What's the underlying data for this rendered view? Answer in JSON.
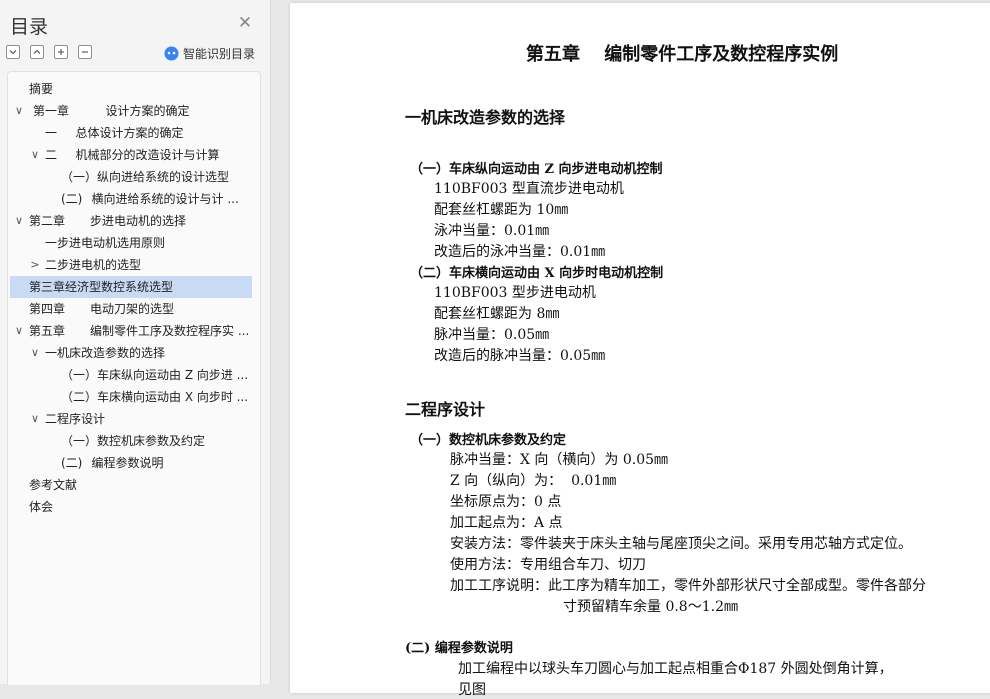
{
  "sidebar": {
    "title": "目录",
    "smart_toc_label": "智能识别目录",
    "toolbar_icons": [
      "collapse-all-icon",
      "expand-all-icon",
      "expand-level-icon",
      "collapse-level-icon"
    ],
    "items": [
      {
        "label": "摘要"
      },
      {
        "label": "第一章\t   设计方案的确定"
      },
      {
        "label": "一\t总体设计方案的确定"
      },
      {
        "label": "二\t机械部分的改造设计与计算"
      },
      {
        "label": "（一）纵向进给系统的设计选型"
      },
      {
        "label": "(二)\t横向进给系统的设计与计 ..."
      },
      {
        "label": "第二章\t步进电动机的选择"
      },
      {
        "label": "一步进电动机选用原则"
      },
      {
        "label": "二步进电机的选型"
      },
      {
        "label": "第三章经济型数控系统选型"
      },
      {
        "label": "第四章\t电动刀架的选型"
      },
      {
        "label": "第五章\t编制零件工序及数控程序实 ..."
      },
      {
        "label": "一机床改造参数的选择"
      },
      {
        "label": "（一）车床纵向运动由 Z 向步进 ..."
      },
      {
        "label": "（二）车床横向运动由 X 向步时 ..."
      },
      {
        "label": "二程序设计"
      },
      {
        "label": "（一）数控机床参数及约定"
      },
      {
        "label": "(二)\t编程参数说明"
      },
      {
        "label": "参考文献"
      },
      {
        "label": "体会"
      }
    ],
    "selected_color": "#c9daf5"
  },
  "document": {
    "chapter_title": "第五章　 编制零件工序及数控程序实例",
    "section1_title": "一机床改造参数的选择",
    "sub1_title": "（一）车床纵向运动由 Z 向步进电动机控制",
    "sub1_lines": [
      "110BF003 型直流步进电动机",
      "配套丝杠螺距为 10㎜",
      "泳冲当量：0.01㎜",
      "改造后的泳冲当量：0.01㎜"
    ],
    "sub2_title": "（二）车床横向运动由 X 向步时电动机控制",
    "sub2_lines": [
      "110BF003 型步进电动机",
      "配套丝杠螺距为 8㎜",
      "脉冲当量：0.05㎜",
      "改造后的脉冲当量：0.05㎜"
    ],
    "section2_title": "二程序设计",
    "sub3_title": "（一）数控机床参数及约定",
    "sub3_lines": [
      "脉冲当量：X 向（横向）为 0.05㎜",
      "Z 向（纵向）为：  0.01㎜",
      "坐标原点为：0 点",
      "加工起点为：A 点",
      "安装方法：零件装夹于床头主轴与尾座顶尖之间。采用专用芯轴方式定位。",
      "使用方法：专用组合车刀、切刀",
      "加工工序说明：此工序为精车加工，零件外部形状尺寸全部成型。零件各部分",
      "寸预留精车余量 0.8～1.2㎜"
    ],
    "sub4_title": "(二) 编程参数说明",
    "sub4_lines": [
      "加工编程中以球头车刀圆心与加工起点相重合Φ187 外圆处倒角计算，",
      "见图"
    ]
  }
}
